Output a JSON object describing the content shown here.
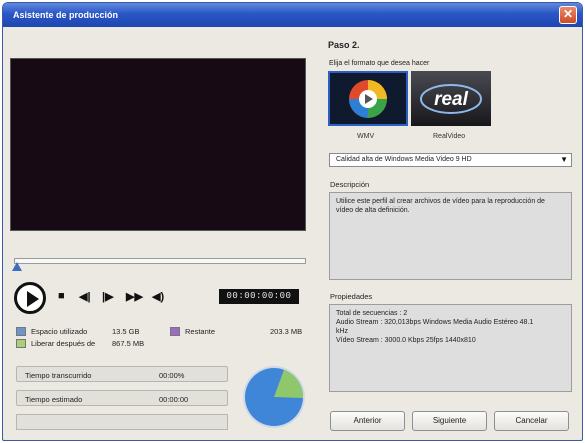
{
  "window": {
    "title": "Asistente de producción",
    "close_glyph": "✕"
  },
  "player": {
    "timecode": "00:00:00:00",
    "icons": [
      "play-icon",
      "stop-icon",
      "prev-frame-icon",
      "next-frame-icon",
      "fast-forward-icon",
      "volume-icon"
    ]
  },
  "space": {
    "used_label": "Espacio utilizado",
    "used_value": "13.5 GB",
    "used_color": "#6f94c9",
    "remaining_label": "Restante",
    "remaining_value": "203.3 MB",
    "remaining_color": "#9b6cc0",
    "free_after_label": "Liberar después de",
    "free_after_value": "867.5 MB",
    "free_after_color": "#a9cf78"
  },
  "stats": {
    "elapsed_label": "Tiempo transcurrido",
    "elapsed_value": "00:00%",
    "estimated_label": "Tiempo estimado",
    "estimated_value": "00:00:00"
  },
  "pie_chart": {
    "main_color": "#3f86d8",
    "slice_color": "#8fc86a",
    "slice_fraction": 0.2
  },
  "step": {
    "title": "Paso 2.",
    "hint": "Elija el formato que desea hacer",
    "formats": [
      {
        "label": "WMV",
        "selected": true
      },
      {
        "label": "RealVideo",
        "selected": false
      }
    ],
    "real_logo_text": "real"
  },
  "quality": {
    "selected": "Calidad alta de Windows Media Video 9 HD"
  },
  "description": {
    "label": "Descripción",
    "lines": [
      "Utilice este perfil al crear archivos de vídeo para la reproducción de",
      "vídeo de alta definición."
    ]
  },
  "properties": {
    "label": "Propiedades",
    "lines": [
      "Total de secuencias : 2",
      "Audio Stream : 320,013bps  Windows Media Audio Estéreo 48.1",
      "kHz",
      "Vídeo Stream : 3000.0 Kbps 25fps  1440x810"
    ]
  },
  "buttons": {
    "back": "Anterior",
    "next": "Siguiente",
    "cancel": "Cancelar"
  }
}
